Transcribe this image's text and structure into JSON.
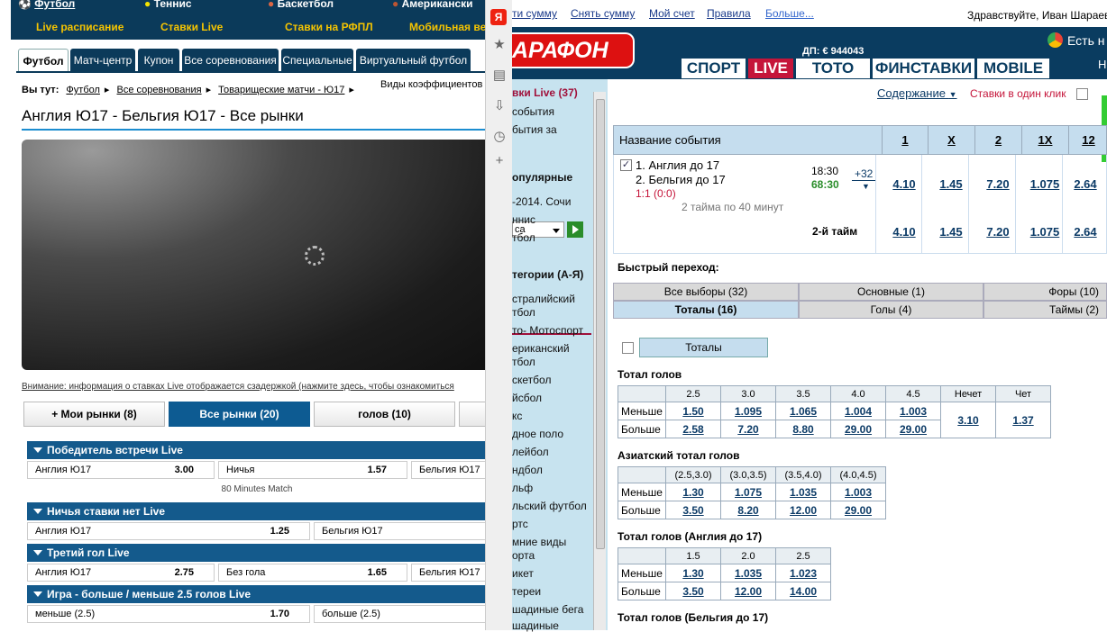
{
  "left": {
    "sports_row1": [
      "Футбол",
      "Теннис",
      "Баскетбол",
      "Американски"
    ],
    "sports_row2": [
      "Live расписание",
      "Ставки Live",
      "Ставки на РФПЛ",
      "Мобильная ве"
    ],
    "tabs": [
      "Футбол",
      "Матч-центр",
      "Купон",
      "Все соревнования",
      "Специальные",
      "Виртуальный футбол"
    ],
    "breadcrumb": {
      "label": "Вы тут:",
      "items": [
        "Футбол",
        "Все соревнования",
        "Товарищеские матчи - Ю17"
      ]
    },
    "odds_view": "Виды коэффициентов",
    "match_title": "Англия Ю17 - Бельгия Ю17 - Все рынки",
    "notice": "Внимание: информация о ставках Live отображается сзадержкой (нажмите здесь, чтобы ознакомиться",
    "market_buttons": [
      "Мои рынки (8)",
      "Все рынки (20)",
      "голов (10)"
    ],
    "sections": [
      {
        "title": "Победитель встречи Live",
        "cells": [
          {
            "label": "Англия Ю17",
            "value": "3.00"
          },
          {
            "label": "Ничья",
            "value": "1.57"
          },
          {
            "label": "Бельгия Ю17",
            "value": ""
          }
        ],
        "note": "80 Minutes Match"
      },
      {
        "title": "Ничья ставки нет Live",
        "cells": [
          {
            "label": "Англия Ю17",
            "value": "1.25"
          },
          {
            "label": "Бельгия Ю17",
            "value": ""
          }
        ]
      },
      {
        "title": "Третий гол Live",
        "cells": [
          {
            "label": "Англия Ю17",
            "value": "2.75"
          },
          {
            "label": "Без гола",
            "value": "1.65"
          },
          {
            "label": "Бельгия Ю17",
            "value": ""
          }
        ]
      },
      {
        "title": "Игра - больше / меньше 2.5 голов Live",
        "cells": [
          {
            "label": "меньше (2.5)",
            "value": "1.70"
          },
          {
            "label": "больше (2.5)",
            "value": ""
          }
        ]
      }
    ]
  },
  "sidebar_icons": [
    "yandex-icon",
    "star-icon",
    "note-icon",
    "download-icon",
    "clock-icon",
    "plus-icon"
  ],
  "right": {
    "top_links": [
      "ти сумму",
      "Снять сумму",
      "Мой счет",
      "Правила",
      "Больше..."
    ],
    "greeting": "Здравствуйте, Иван Шараев",
    "logo": "АРАФОН",
    "dp": "ДП: € 944043",
    "chrome_text": "Есть н",
    "chrome_under": "Н",
    "nav": [
      "СПОРТ",
      "LIVE",
      "ТОТО",
      "ФИНСТАВКИ",
      "MOBILE"
    ],
    "left_nav": {
      "live": "вки Live (37)",
      "events": "события",
      "events_for": "бытия за",
      "select": "са",
      "popular": "опулярные",
      "popular_items": [
        "-2014. Сочи",
        "ннис",
        "тбол"
      ],
      "categories": "тегории (А-Я)",
      "category_items": [
        "стралийский",
        "тбол",
        "то- Мотоспорт",
        "ериканский",
        "тбол",
        "скетбол",
        "йсбол",
        "кс",
        "дное поло",
        "лейбол",
        "ндбол",
        "льф",
        "льский футбол",
        "ртс",
        "мние виды",
        "орта",
        "икет",
        "тереи",
        "шадиные бега",
        "шадиные"
      ]
    },
    "contents": "Содержание",
    "one_click": "Ставки в один клик",
    "header_cols": [
      "Название события",
      "1",
      "X",
      "2",
      "1X",
      "12"
    ],
    "event": {
      "team1": "1. Англия до 17",
      "team2": "2. Бельгия до 17",
      "score": "1:1 (0:0)",
      "format": "2 тайма по 40 минут",
      "time": "18:30",
      "minute": "68:30",
      "more": "+32",
      "odds": [
        "4.10",
        "1.45",
        "7.20",
        "1.075",
        "2.64"
      ],
      "half_label": "2-й тайм",
      "half_odds": [
        "4.10",
        "1.45",
        "7.20",
        "1.075",
        "2.64"
      ]
    },
    "quick_jump": "Быстрый переход:",
    "filters_row1": [
      "Все выборы (32)",
      "Основные (1)",
      "Форы (10)"
    ],
    "filters_row2": [
      "Тоталы (16)",
      "Голы (4)",
      "Таймы (2)"
    ],
    "totals_button": "Тоталы",
    "total_goals": {
      "title": "Тотал голов",
      "cols": [
        "2.5",
        "3.0",
        "3.5",
        "4.0",
        "4.5",
        "Нечет",
        "Чет"
      ],
      "rows": [
        {
          "label": "Меньше",
          "odds": [
            "1.50",
            "1.095",
            "1.065",
            "1.004",
            "1.003"
          ]
        },
        {
          "label": "Больше",
          "odds": [
            "2.58",
            "7.20",
            "8.80",
            "29.00",
            "29.00"
          ]
        }
      ],
      "odd": "3.10",
      "even": "1.37"
    },
    "asian_total": {
      "title": "Азиатский тотал голов",
      "cols": [
        "(2.5,3.0)",
        "(3.0,3.5)",
        "(3.5,4.0)",
        "(4.0,4.5)"
      ],
      "rows": [
        {
          "label": "Меньше",
          "odds": [
            "1.30",
            "1.075",
            "1.035",
            "1.003"
          ]
        },
        {
          "label": "Больше",
          "odds": [
            "3.50",
            "8.20",
            "12.00",
            "29.00"
          ]
        }
      ]
    },
    "england_total": {
      "title": "Тотал голов (Англия до 17)",
      "cols": [
        "1.5",
        "2.0",
        "2.5"
      ],
      "rows": [
        {
          "label": "Меньше",
          "odds": [
            "1.30",
            "1.035",
            "1.023"
          ]
        },
        {
          "label": "Больше",
          "odds": [
            "3.50",
            "12.00",
            "14.00"
          ]
        }
      ]
    },
    "belgium_total_title": "Тотал голов (Бельгия до 17)"
  }
}
